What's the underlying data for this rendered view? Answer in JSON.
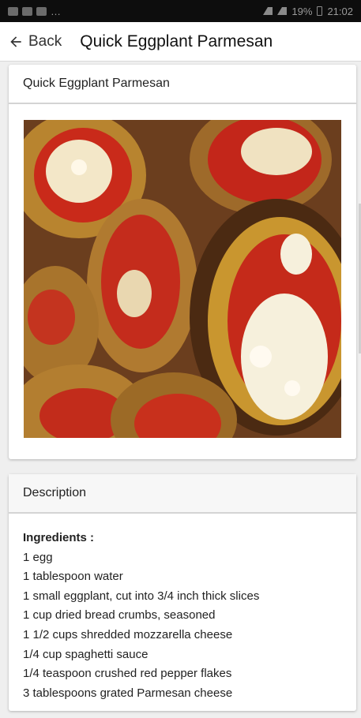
{
  "status_bar": {
    "battery": "19%",
    "time": "21:02"
  },
  "app_bar": {
    "back_label": "Back",
    "title": "Quick Eggplant Parmesan"
  },
  "recipe_card": {
    "title": "Quick Eggplant Parmesan",
    "image_alt": "eggplant-parmesan-photo"
  },
  "description": {
    "heading": "Description",
    "ingredients_label": "Ingredients :",
    "items": [
      "1 egg",
      "1 tablespoon water",
      "1 small eggplant, cut into 3/4 inch thick slices",
      "1 cup dried bread crumbs, seasoned",
      "1 1/2 cups shredded mozzarella cheese",
      "1/4 cup spaghetti sauce",
      "1/4 teaspoon crushed red pepper flakes",
      "3 tablespoons grated Parmesan cheese"
    ]
  }
}
